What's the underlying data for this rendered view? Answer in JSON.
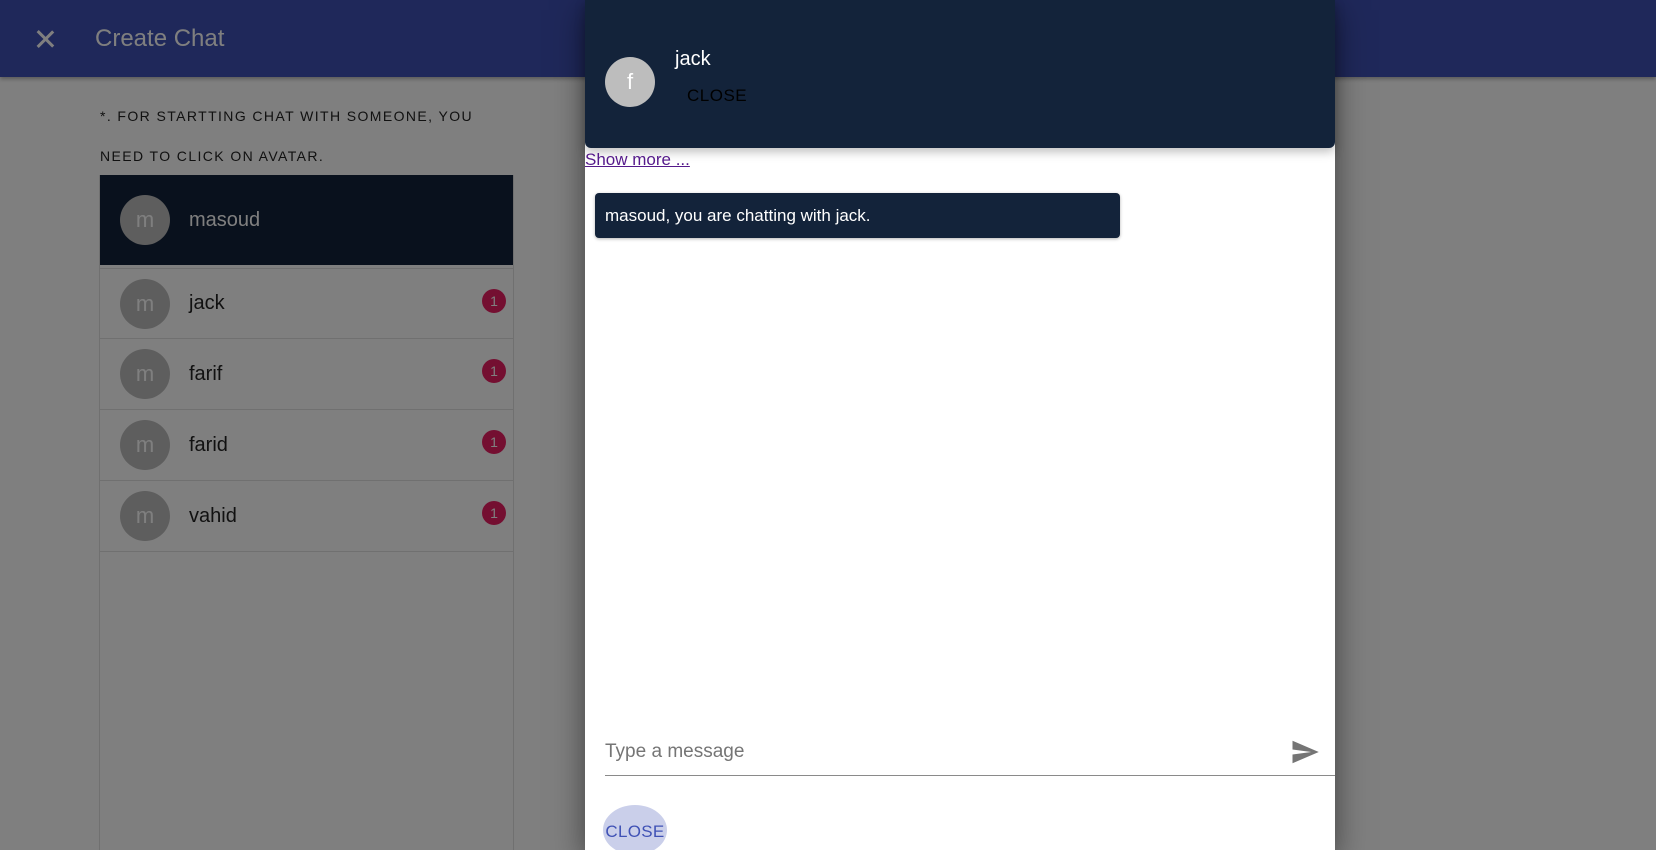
{
  "appbar": {
    "title": "Create Chat",
    "close_icon": "close-icon"
  },
  "hint_text": "*. For startting chat with someone, you need to click on avatar.",
  "current_user": {
    "avatar_letter": "m",
    "name": "masoud"
  },
  "contacts": [
    {
      "avatar_letter": "m",
      "name": "jack",
      "unread": "1"
    },
    {
      "avatar_letter": "m",
      "name": "farif",
      "unread": "1"
    },
    {
      "avatar_letter": "m",
      "name": "farid",
      "unread": "1"
    },
    {
      "avatar_letter": "m",
      "name": "vahid",
      "unread": "1"
    }
  ],
  "dialog": {
    "header": {
      "avatar_letter": "f",
      "contact_name": "jack",
      "close_label": "CLOSE"
    },
    "show_more_label": "Show more ...",
    "system_message": "masoud, you are chatting with jack.",
    "composer": {
      "placeholder": "Type a message",
      "send_icon": "send-icon"
    },
    "close_button_label": "CLOSE"
  },
  "colors": {
    "primary": "#3f51b5",
    "dark_navy": "#13233a",
    "badge": "#e91e63"
  }
}
